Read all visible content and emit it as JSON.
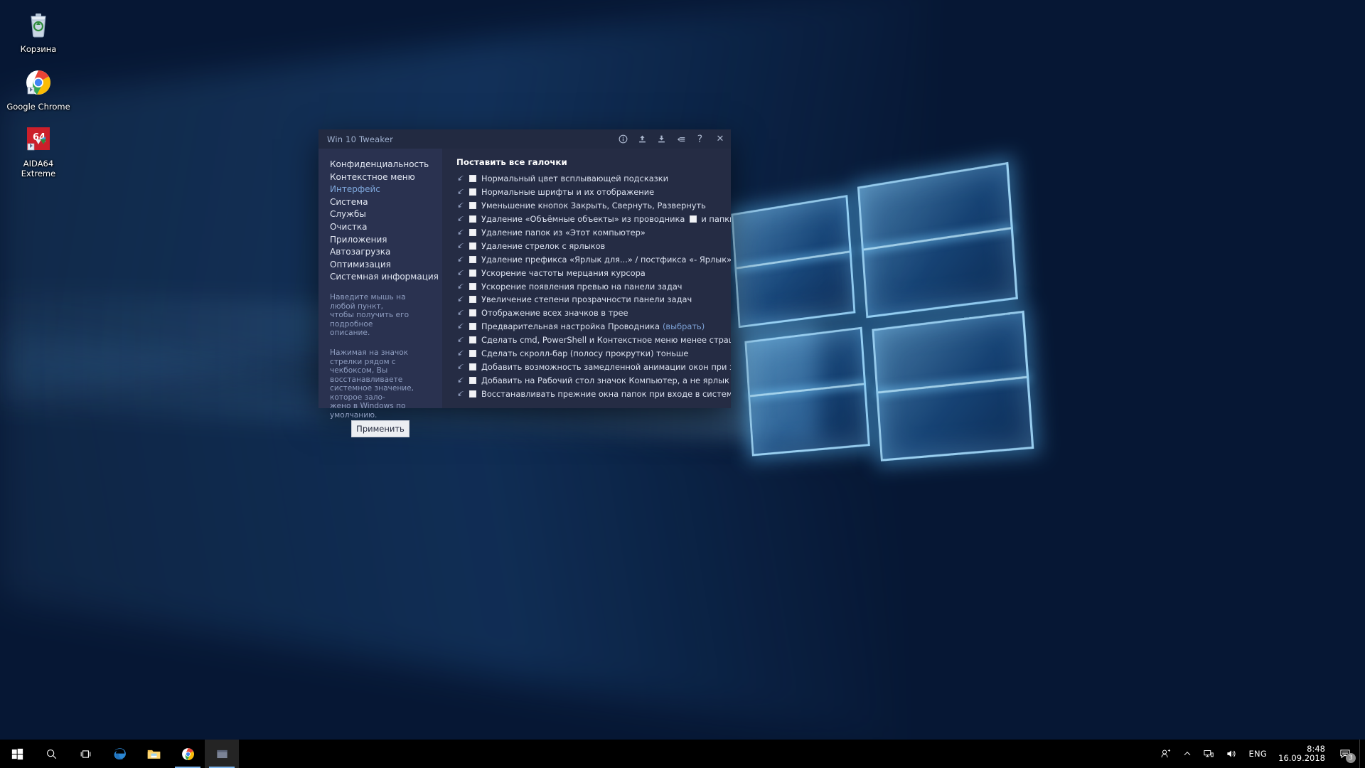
{
  "desktop": {
    "icons": [
      {
        "label": "Корзина",
        "icon": "recycle-bin-icon"
      },
      {
        "label": "Google Chrome",
        "icon": "chrome-icon"
      },
      {
        "label": "AIDA64 Extreme",
        "icon": "aida64-icon"
      }
    ]
  },
  "window": {
    "title": "Win 10 Tweaker",
    "title_actions": [
      {
        "name": "info-icon",
        "tooltip": "info"
      },
      {
        "name": "export-icon",
        "tooltip": "export"
      },
      {
        "name": "import-icon",
        "tooltip": "import"
      },
      {
        "name": "list-icon",
        "tooltip": "log"
      },
      {
        "name": "help-icon",
        "label": "?"
      },
      {
        "name": "close-icon",
        "label": "✕"
      }
    ]
  },
  "sidebar": {
    "items": [
      {
        "label": "Конфиденциальность",
        "active": false
      },
      {
        "label": "Контекстное меню",
        "active": false
      },
      {
        "label": "Интерфейс",
        "active": true
      },
      {
        "label": "Система",
        "active": false
      },
      {
        "label": "Службы",
        "active": false
      },
      {
        "label": "Очистка",
        "active": false
      },
      {
        "label": "Приложения",
        "active": false
      },
      {
        "label": "Автозагрузка",
        "active": false
      },
      {
        "label": "Оптимизация",
        "active": false
      },
      {
        "label": "Системная информация",
        "active": false
      }
    ],
    "hint_1": "Наведите мышь на любой пункт,\nчтобы получить его подробное\nописание.",
    "hint_2": "Нажимая на значок стрелки рядом с\nчекбоксом, Вы восстанавливаете\nсистемное значение, которое зало-\nжено в Windows по умолчанию.",
    "apply_label": "Применить"
  },
  "content": {
    "header": "Поставить все галочки",
    "tweaks": [
      {
        "label": "Нормальный цвет всплывающей подсказки",
        "checked": false
      },
      {
        "label": "Нормальные шрифты и их отображение",
        "checked": false
      },
      {
        "label": "Уменьшение кнопок Закрыть, Свернуть, Развернуть",
        "checked": false
      },
      {
        "label": "Удаление «Объёмные объекты» из проводника",
        "checked": false,
        "extra_checkbox": true,
        "extra_label": "и папки",
        "extra_checked": false
      },
      {
        "label": "Удаление папок из «Этот компьютер»",
        "checked": false
      },
      {
        "label": "Удаление стрелок с ярлыков",
        "checked": false
      },
      {
        "label": "Удаление префикса «Ярлык для...» / постфикса «- Ярлык»",
        "checked": false
      },
      {
        "label": "Ускорение частоты мерцания курсора",
        "checked": false
      },
      {
        "label": "Ускорение появления превью на панели задач",
        "checked": false
      },
      {
        "label": "Увеличение степени прозрачности панели задач",
        "checked": false
      },
      {
        "label": "Отображение всех значков в трее",
        "checked": false
      },
      {
        "label": "Предварительная настройка Проводника",
        "checked": false,
        "link": "(выбрать)"
      },
      {
        "label": "Сделать cmd, PowerShell и Контекстное меню менее страшными",
        "checked": false
      },
      {
        "label": "Сделать скролл-бар (полосу прокрутки) тоньше",
        "checked": false
      },
      {
        "label": "Добавить возможность замедленной анимации окон при зажатом Shift",
        "checked": false
      },
      {
        "label": "Добавить на Рабочий стол значок Компьютер, а не ярлык",
        "checked": false
      },
      {
        "label": "Восстанавливать прежние окна папок при входе в систему",
        "checked": false
      }
    ]
  },
  "taskbar": {
    "buttons": [
      {
        "name": "start-button",
        "icon": "windows-icon"
      },
      {
        "name": "search-button",
        "icon": "search-icon"
      },
      {
        "name": "task-view-button",
        "icon": "task-view-icon"
      },
      {
        "name": "edge-button",
        "icon": "edge-icon"
      },
      {
        "name": "explorer-button",
        "icon": "folder-icon"
      },
      {
        "name": "chrome-button",
        "icon": "chrome-icon"
      },
      {
        "name": "tweaker-button",
        "icon": "tweaker-icon"
      }
    ],
    "tray": {
      "people_icon": "people-icon",
      "chevron_icon": "chevron-up-icon",
      "network_icon": "network-icon",
      "volume_icon": "volume-icon",
      "language": "ENG",
      "time": "8:48",
      "date": "16.09.2018",
      "notification_count": "3"
    }
  },
  "colors": {
    "window_bg": "#242b43",
    "sidebar_bg": "#2a3250",
    "content_bg": "#252c44",
    "accent": "#7fa8dd",
    "link": "#7da2d6",
    "taskbar_bg": "#000000"
  }
}
